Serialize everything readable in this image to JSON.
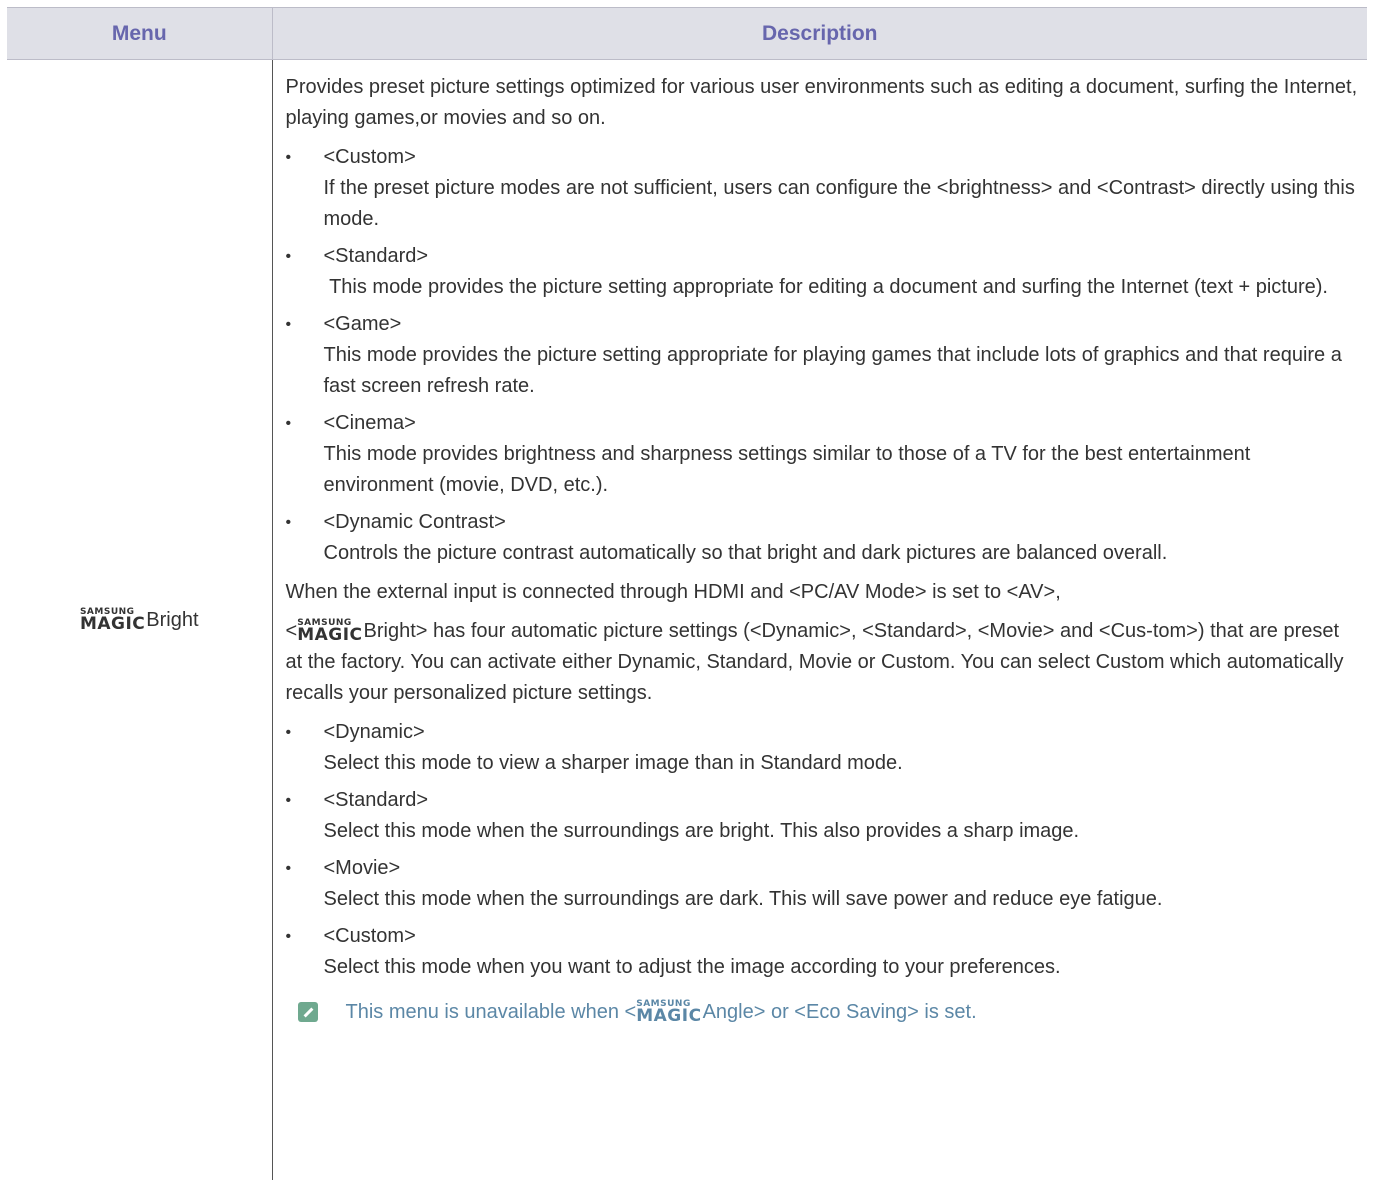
{
  "header": {
    "menu_label": "Menu",
    "description_label": "Description"
  },
  "row": {
    "logo_top": "SAMSUNG",
    "logo_bottom": "MAGIC",
    "menu_name": "Bright",
    "intro": "Provides preset picture settings optimized for various user environments such as editing a document, surfing the Internet, playing games,or movies and so on.",
    "modes": [
      {
        "title": "<Custom>",
        "text": "If the preset picture modes are not sufficient, users can configure the <brightness> and <Contrast> directly using this mode."
      },
      {
        "title": "<Standard>",
        "text": " This mode provides the picture setting appropriate for editing a document and surfing the Internet (text + picture)."
      },
      {
        "title": "<Game>",
        "text": "This mode provides the picture setting appropriate for playing games that include lots of graphics and that require a fast screen refresh rate."
      },
      {
        "title": "<Cinema>",
        "text": "This mode provides brightness and sharpness settings similar to those of a TV for the best entertainment environment (movie, DVD, etc.)."
      },
      {
        "title": "<Dynamic Contrast>",
        "text": "Controls the picture contrast automatically so that bright and dark pictures are balanced overall."
      }
    ],
    "hdmi_line": "When the external input is connected through HDMI and <PC/AV Mode> is set to <AV>,",
    "av_prefix": "<",
    "av_text": "Bright> has four automatic picture settings (<Dynamic>, <Standard>, <Movie> and <Cus-tom>) that are preset at the factory. You can activate either Dynamic, Standard, Movie or Custom. You can select Custom which automatically recalls your personalized picture settings.",
    "av_modes": [
      {
        "title": "<Dynamic>",
        "text": "Select this mode to view a sharper image than in Standard mode."
      },
      {
        "title": "<Standard>",
        "text": "Select this mode when the surroundings are bright. This also provides a sharp image."
      },
      {
        "title": "<Movie>",
        "text": "Select this mode when the surroundings are dark. This will save power and reduce eye fatigue."
      },
      {
        "title": "<Custom>",
        "text": "Select this mode when you want to adjust the image according to your preferences."
      }
    ],
    "note_prefix": "This menu is unavailable when <",
    "note_suffix": "Angle> or <Eco Saving> is set.",
    "bullet": "•"
  },
  "colors": {
    "header_bg": "#dfe0e7",
    "header_text": "#6766ad",
    "note_text": "#5b87a6",
    "note_icon": "#6fa98f"
  }
}
